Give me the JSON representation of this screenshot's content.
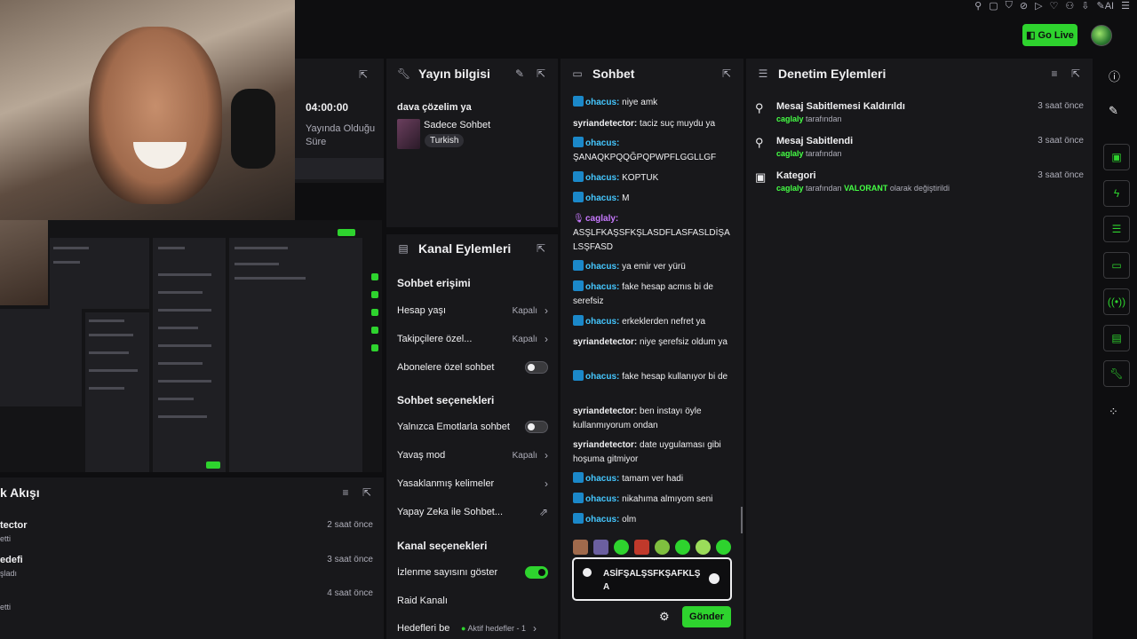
{
  "top": {
    "go_live": "Go Live"
  },
  "stat": {
    "time": "04:00:00",
    "label": "Yayında Olduğu Süre"
  },
  "activity": {
    "title": "k Akışı",
    "rows": [
      {
        "name": "tector",
        "sub": "etti",
        "time": "2 saat önce"
      },
      {
        "name": "edefi",
        "sub": "şladı",
        "time": "3 saat önce"
      },
      {
        "name": "",
        "sub": "etti",
        "time": "4 saat önce"
      }
    ]
  },
  "stream_info": {
    "title": "Yayın bilgisi",
    "stream_title": "dava çözelim ya",
    "category": "Sadece Sohbet",
    "tag": "Turkish"
  },
  "channel": {
    "title": "Kanal Eylemleri",
    "sec_chat_access": "Sohbet erişimi",
    "account_age": "Hesap yaşı",
    "account_age_val": "Kapalı",
    "followers_only": "Takipçilere özel...",
    "followers_only_val": "Kapalı",
    "subs_only": "Abonelere özel sohbet",
    "sec_chat_options": "Sohbet seçenekleri",
    "emote_only": "Yalnızca Emotlarla sohbet",
    "slow_mode": "Yavaş mod",
    "slow_mode_val": "Kapalı",
    "banned_words": "Yasaklanmış kelimeler",
    "ai_chat": "Yapay Zeka ile Sohbet...",
    "sec_channel_options": "Kanal seçenekleri",
    "show_viewers": "İzlenme sayısını göster",
    "raid_channel": "Raid Kanalı",
    "goals": "Hedefleri be",
    "goals_val": "Aktif hedefler - 1"
  },
  "chat": {
    "title": "Sohbet",
    "messages": [
      {
        "user": "ohacus",
        "text": "niye amk"
      },
      {
        "user": "syriandetector",
        "text": "taciz suç muydu ya"
      },
      {
        "user": "ohacus",
        "text": "ŞANAQKPQQĞPQPWPFLGGLLGF"
      },
      {
        "user": "ohacus",
        "text": "KOPTUK"
      },
      {
        "user": "ohacus",
        "text": "M"
      },
      {
        "user": "caglaly",
        "text": "ASŞLFKAŞSFKŞLASDFLASFASLDİŞALSŞFASD"
      },
      {
        "user": "ohacus",
        "text": "ya emir ver yürü"
      },
      {
        "user": "ohacus",
        "text": "fake hesap acmıs bi de serefsiz"
      },
      {
        "user": "ohacus",
        "text": "erkeklerden nefret ya"
      },
      {
        "user": "syriandetector",
        "text": "niye şerefsiz oldum ya"
      },
      {
        "user": "ohacus",
        "text": "fake hesap kullanıyor bi de"
      },
      {
        "user": "syriandetector",
        "text": "ben instayı öyle kullanmıyorum ondan"
      },
      {
        "user": "syriandetector",
        "text": "date uygulaması gibi hoşuma gitmiyor"
      },
      {
        "user": "ohacus",
        "text": "tamam ver hadi"
      },
      {
        "user": "ohacus",
        "text": "nikahıma almıyom seni"
      },
      {
        "user": "ohacus",
        "text": "olm"
      }
    ],
    "input_value": "ASİFŞALŞSFKŞAFKLŞA",
    "send": "Gönder"
  },
  "mod": {
    "title": "Denetim Eylemleri",
    "rows": [
      {
        "name": "Mesaj Sabitlemesi Kaldırıldı",
        "user": "caglaly",
        "suffix": " tarafından",
        "time": "3 saat önce"
      },
      {
        "name": "Mesaj Sabitlendi",
        "user": "caglaly",
        "suffix": " tarafından",
        "time": "3 saat önce"
      },
      {
        "name": "Kategori",
        "user": "caglaly",
        "suffix": " tarafından ",
        "extra": "VALORANT",
        "suffix2": " olarak değiştirildi",
        "time": "3 saat önce"
      }
    ]
  },
  "colors": {
    "accent": "#2ed32e",
    "panel": "#18181b",
    "bg": "#0e0e10",
    "user": "#45c7ff",
    "syrian": "#efeff1",
    "caglaly": "#c879ff"
  }
}
